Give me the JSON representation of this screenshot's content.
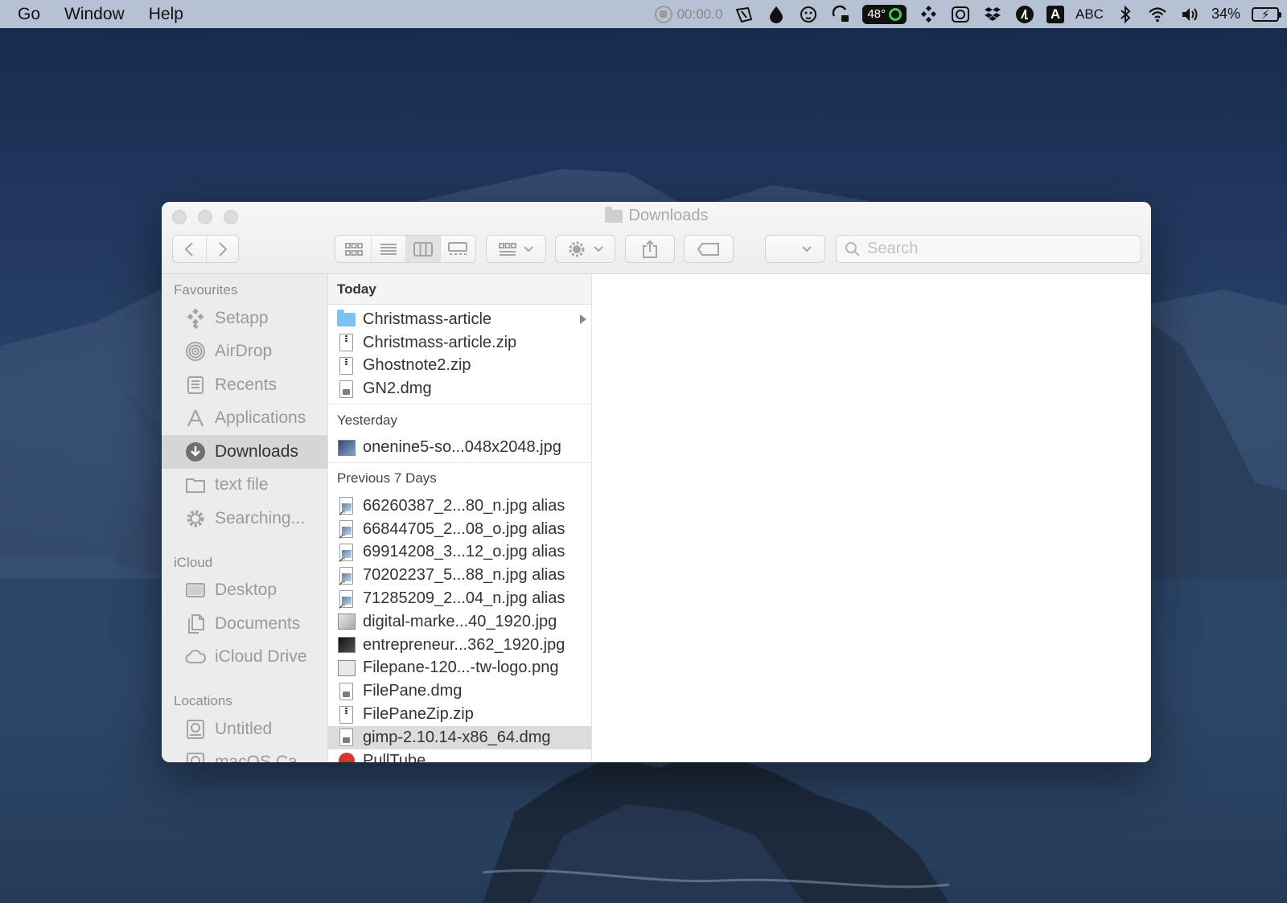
{
  "menubar": {
    "menus": [
      "Go",
      "Window",
      "Help"
    ],
    "timer": "00:00.0",
    "temperature": "48°",
    "input_letter": "A",
    "input_source": "ABC",
    "battery_percent": "34%",
    "icons": [
      "record-icon",
      "pen-icon",
      "drop-icon",
      "monkey-icon",
      "lock-icon",
      "weather-icon",
      "setapp-icon",
      "screenshot-icon",
      "dropbox-icon",
      "app-icon",
      "keyboard-icon",
      "bluetooth-icon",
      "wifi-icon",
      "volume-icon",
      "battery-icon"
    ]
  },
  "window": {
    "title": "Downloads",
    "search_placeholder": "Search"
  },
  "sidebar": {
    "sections": [
      {
        "title": "Favourites",
        "items": [
          {
            "label": "Setapp",
            "icon": "setapp-icon"
          },
          {
            "label": "AirDrop",
            "icon": "airdrop-icon"
          },
          {
            "label": "Recents",
            "icon": "recents-icon"
          },
          {
            "label": "Applications",
            "icon": "applications-icon"
          },
          {
            "label": "Downloads",
            "icon": "downloads-icon",
            "selected": true
          },
          {
            "label": "text file",
            "icon": "folder-icon"
          },
          {
            "label": "Searching...",
            "icon": "gear-icon"
          }
        ]
      },
      {
        "title": "iCloud",
        "items": [
          {
            "label": "Desktop",
            "icon": "desktop-icon"
          },
          {
            "label": "Documents",
            "icon": "documents-icon"
          },
          {
            "label": "iCloud Drive",
            "icon": "cloud-icon"
          }
        ]
      },
      {
        "title": "Locations",
        "items": [
          {
            "label": "Untitled",
            "icon": "disk-icon"
          },
          {
            "label": "macOS Ca...",
            "icon": "disk-icon"
          }
        ]
      }
    ]
  },
  "column": {
    "groups": [
      {
        "title": "Today",
        "files": [
          {
            "name": "Christmass-article",
            "kind": "folder"
          },
          {
            "name": "Christmass-article.zip",
            "kind": "zip"
          },
          {
            "name": "Ghostnote2.zip",
            "kind": "zip"
          },
          {
            "name": "GN2.dmg",
            "kind": "dmg"
          }
        ]
      },
      {
        "title": "Yesterday",
        "files": [
          {
            "name": "onenine5-so...048x2048.jpg",
            "kind": "image"
          }
        ]
      },
      {
        "title": "Previous 7 Days",
        "files": [
          {
            "name": "66260387_2...80_n.jpg alias",
            "kind": "alias"
          },
          {
            "name": "66844705_2...08_o.jpg alias",
            "kind": "alias"
          },
          {
            "name": "69914208_3...12_o.jpg alias",
            "kind": "alias"
          },
          {
            "name": "70202237_5...88_n.jpg alias",
            "kind": "alias"
          },
          {
            "name": "71285209_2...04_n.jpg alias",
            "kind": "alias"
          },
          {
            "name": "digital-marke...40_1920.jpg",
            "kind": "image-light"
          },
          {
            "name": "entrepreneur...362_1920.jpg",
            "kind": "image-dark"
          },
          {
            "name": "Filepane-120...-tw-logo.png",
            "kind": "image-logo"
          },
          {
            "name": "FilePane.dmg",
            "kind": "dmg"
          },
          {
            "name": "FilePaneZip.zip",
            "kind": "zip"
          },
          {
            "name": "gimp-2.10.14-x86_64.dmg",
            "kind": "dmg",
            "selected": true
          },
          {
            "name": "PullTube",
            "kind": "app"
          }
        ]
      }
    ]
  }
}
